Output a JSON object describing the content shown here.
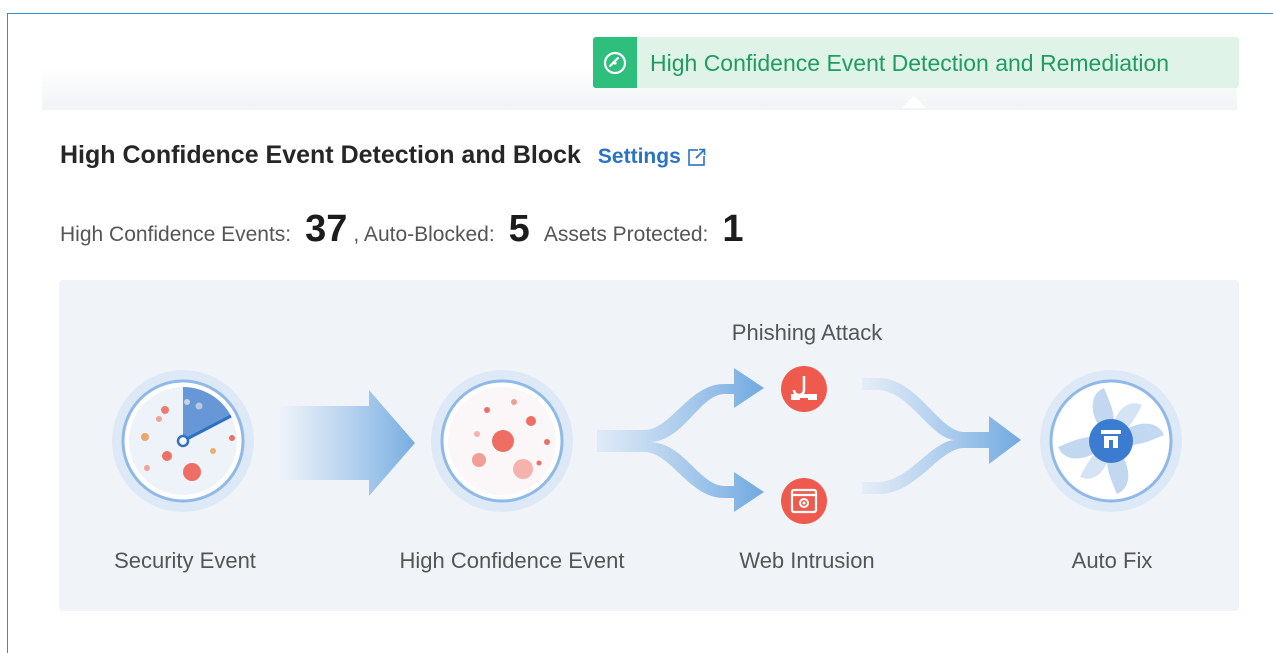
{
  "tag": {
    "label": "High Confidence Event Detection and Remediation",
    "icon": "gauge-icon"
  },
  "header": {
    "title": "High Confidence Event Detection and Block",
    "settings_label": "Settings",
    "settings_icon": "external-link-icon"
  },
  "stats": {
    "high_conf_label": "High Confidence Events:",
    "high_conf_value": "37",
    "auto_blocked_label": ", Auto-Blocked:",
    "auto_blocked_value": "5",
    "assets_label": "Assets Protected:",
    "assets_value": "1"
  },
  "flow": {
    "security_event": "Security Event",
    "high_confidence_event": "High Confidence Event",
    "phishing_attack": "Phishing Attack",
    "web_intrusion": "Web Intrusion",
    "auto_fix": "Auto Fix"
  },
  "colors": {
    "accent_green": "#2fbf7d",
    "link_blue": "#2a73c4",
    "danger_red": "#ee5b4e",
    "flow_blue": "#7fb3e5"
  }
}
